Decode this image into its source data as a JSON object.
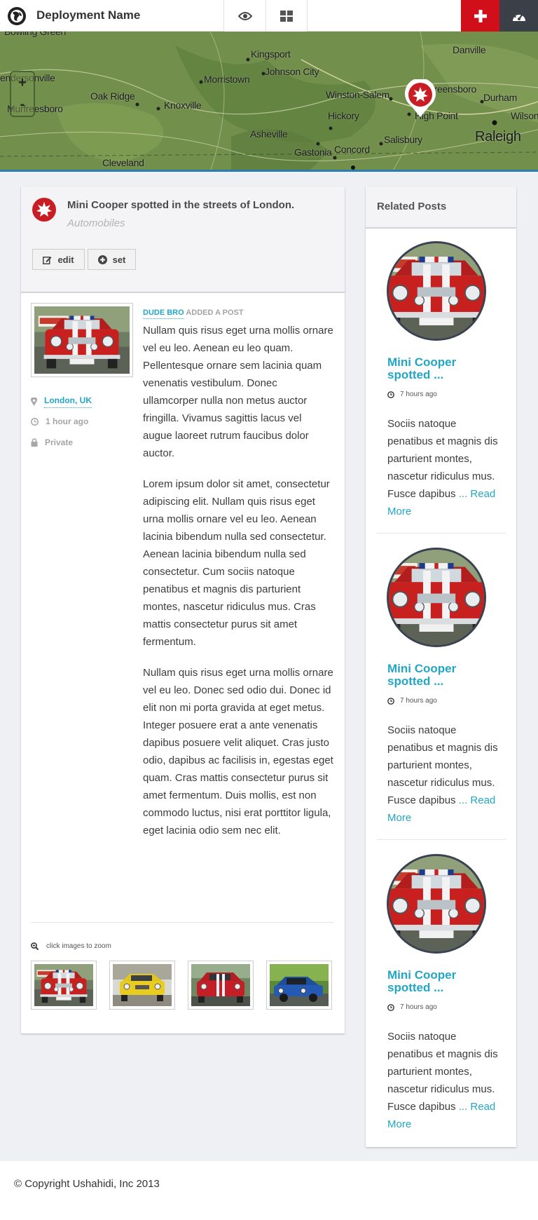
{
  "header": {
    "title": "Deployment Name"
  },
  "map": {
    "zoom_in": "+",
    "zoom_out": "-",
    "places": [
      "Bowling Green",
      "endersonville",
      "Murfreesboro",
      "Oak Ridge",
      "Knoxville",
      "Morristown",
      "Kingsport",
      "Johnson City",
      "Asheville",
      "Cleveland",
      "Winston-Salem",
      "Greensboro",
      "Danville",
      "Durham",
      "Wilson",
      "Hickory",
      "High Point",
      "Salisbury",
      "Concord",
      "Gastonia",
      "Raleigh"
    ]
  },
  "post": {
    "title": "Mini Cooper spotted in the streets of London.",
    "category": "Automobiles",
    "edit_label": "edit",
    "set_label": "set",
    "author": "DUDE BRO",
    "action": " ADDED A POST",
    "location": "London, UK",
    "time": "1 hour ago",
    "visibility": "Private",
    "paragraphs": [
      "Nullam quis risus eget urna mollis ornare vel eu leo. Aenean eu leo quam. Pellentesque ornare sem lacinia quam venenatis vestibulum. Donec ullamcorper nulla non metus auctor fringilla. Vivamus sagittis lacus vel augue laoreet rutrum faucibus dolor auctor.",
      "Lorem ipsum dolor sit amet, consectetur adipiscing elit. Nullam quis risus eget urna mollis ornare vel eu leo. Aenean lacinia bibendum nulla sed consectetur. Aenean lacinia bibendum nulla sed consectetur. Cum sociis natoque penatibus et magnis dis parturient montes, nascetur ridiculus mus. Cras mattis consectetur purus sit amet fermentum.",
      "Nullam quis risus eget urna mollis ornare vel eu leo. Donec sed odio dui. Donec id elit non mi porta gravida at eget metus. Integer posuere erat a ante venenatis dapibus posuere velit aliquet. Cras justo odio, dapibus ac facilisis in, egestas eget quam. Cras mattis consectetur purus sit amet fermentum. Duis mollis, est non commodo luctus, nisi erat porttitor ligula, eget lacinia odio sem nec elit."
    ],
    "zoom_hint": "click images to zoom",
    "colors": {
      "accent": "#22a6c3",
      "brand_red": "#d10f1b",
      "dark": "#3b4048"
    }
  },
  "related": {
    "title": "Related Posts",
    "items": [
      {
        "title": "Mini Cooper spotted ...",
        "time": "7 hours ago",
        "excerpt": "Sociis natoque penatibus et magnis dis parturient montes, nascetur ridiculus mus. Fusce dapibus",
        "more": "... Read More"
      },
      {
        "title": "Mini Cooper spotted ...",
        "time": "7 hours ago",
        "excerpt": "Sociis natoque penatibus et magnis dis parturient montes, nascetur ridiculus mus. Fusce dapibus",
        "more": "... Read More"
      },
      {
        "title": "Mini Cooper spotted ...",
        "time": "7 hours ago",
        "excerpt": "Sociis natoque penatibus et magnis dis parturient montes, nascetur ridiculus mus. Fusce dapibus",
        "more": "... Read More"
      }
    ]
  },
  "footer": {
    "copyright": "© Copyright Ushahidi, Inc 2013"
  },
  "icons": {
    "logo": "globe-logo-icon",
    "eye": "eye-icon",
    "grid": "grid-icon",
    "add": "plus-icon",
    "dashboard": "speedometer-icon",
    "location": "map-pin-icon",
    "time": "clock-icon",
    "privacy": "lock-icon",
    "zoom": "magnifier-icon"
  }
}
